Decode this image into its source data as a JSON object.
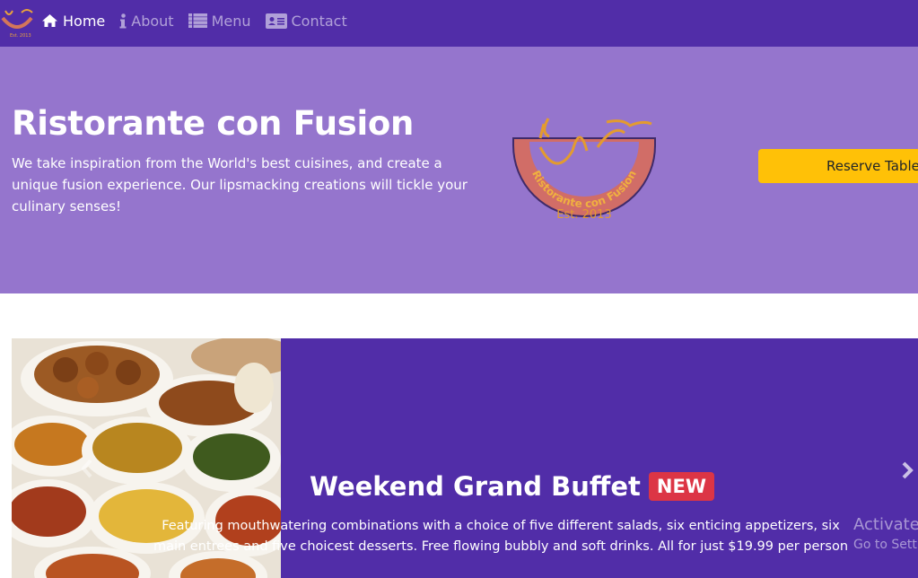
{
  "navbar": {
    "items": [
      {
        "label": "Home",
        "icon": "home-icon"
      },
      {
        "label": "About",
        "icon": "info-icon"
      },
      {
        "label": "Menu",
        "icon": "list-icon"
      },
      {
        "label": "Contact",
        "icon": "address-card-icon"
      }
    ]
  },
  "jumbotron": {
    "title": "Ristorante con Fusion",
    "text": "We take inspiration from the World's best cuisines, and create a unique fusion experience. Our lipsmacking creations will tickle your culinary senses!",
    "logo_text": "Ristorante con Fusion",
    "logo_est": "Est. 2013",
    "reserve_label": "Reserve Table"
  },
  "carousel": {
    "title": "Weekend Grand Buffet",
    "badge": "NEW",
    "text": "Featuring mouthwatering combinations with a choice of five different salads, six enticing appetizers, six main entrees and five choicest desserts. Free flowing bubbly and soft drinks. All for just $19.99 per person"
  },
  "watermark": {
    "line1": "Activate",
    "line2": "Go to Setti"
  },
  "colors": {
    "primary": "#512da8",
    "light": "#9575cd",
    "warning": "#ffc107",
    "danger": "#dc3545"
  }
}
